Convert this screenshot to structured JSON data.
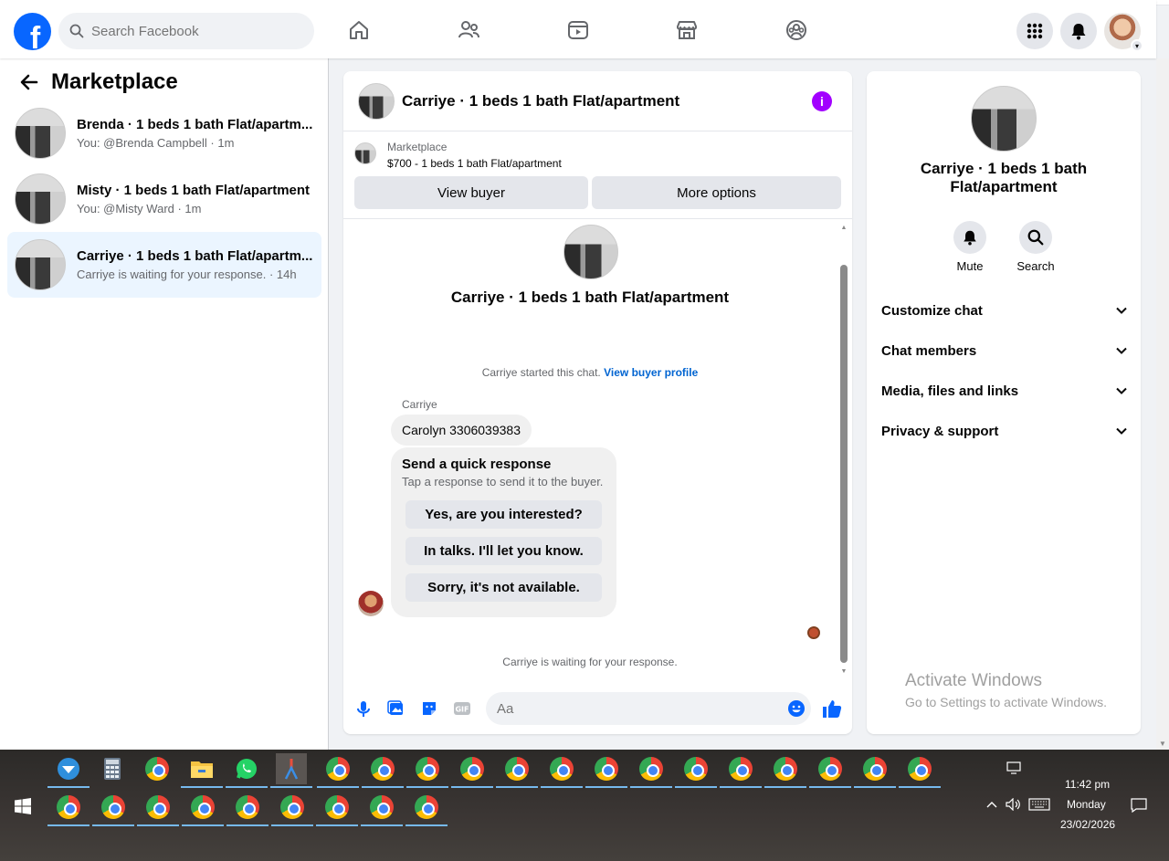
{
  "topbar": {
    "search_placeholder": "Search Facebook",
    "logo": "f",
    "nav_icons": [
      "home-icon",
      "friends-icon",
      "watch-icon",
      "marketplace-icon",
      "groups-icon"
    ],
    "right_icons": [
      "menu-grid-icon",
      "notifications-bell-icon",
      "profile-avatar"
    ]
  },
  "sidebar": {
    "title": "Marketplace",
    "conversations": [
      {
        "title": "Brenda · 1 beds 1 bath Flat/apartm...",
        "subtitle": "You: @Brenda Campbell · 1m",
        "active": false
      },
      {
        "title": "Misty · 1 beds 1 bath Flat/apartment",
        "subtitle": "You: @Misty Ward · 1m",
        "active": false
      },
      {
        "title": "Carriye · 1 beds 1 bath Flat/apartm...",
        "subtitle": "Carriye is waiting for your response. · 14h",
        "active": true
      }
    ]
  },
  "chat": {
    "header_title": "Carriye · 1 beds 1 bath Flat/apartment",
    "info_icon": "i",
    "listing_source": "Marketplace",
    "listing_price_title": "$700 - 1 beds 1 bath Flat/apartment",
    "view_buyer_label": "View buyer",
    "more_options_label": "More options",
    "center_title": "Carriye · 1 beds 1 bath Flat/apartment",
    "started_text": "Carriye started this chat.",
    "view_profile_link": "View buyer profile",
    "sender_name": "Carriye",
    "message_text": "Carolyn 3306039383",
    "quick_response_title": "Send a quick response",
    "quick_response_subtitle": "Tap a response to send it to the buyer.",
    "quick_responses": [
      "Yes, are you interested?",
      "In talks. I'll let you know.",
      "Sorry, it's not available."
    ],
    "waiting_text": "Carriye is waiting for your response.",
    "composer_placeholder": "Aa"
  },
  "right_panel": {
    "title": "Carriye · 1 beds 1 bath Flat/apartment",
    "mute_label": "Mute",
    "search_label": "Search",
    "sections": [
      "Customize chat",
      "Chat members",
      "Media, files and links",
      "Privacy & support"
    ]
  },
  "watermark": {
    "line1": "Activate Windows",
    "line2": "Go to Settings to activate Windows."
  },
  "taskbar": {
    "time": "11:42 pm",
    "day": "Monday",
    "date": "23/02/2026"
  },
  "colors": {
    "facebook_blue": "#0866ff",
    "messenger_purple": "#a200ff",
    "active_conversation_bg": "#ebf5ff"
  }
}
